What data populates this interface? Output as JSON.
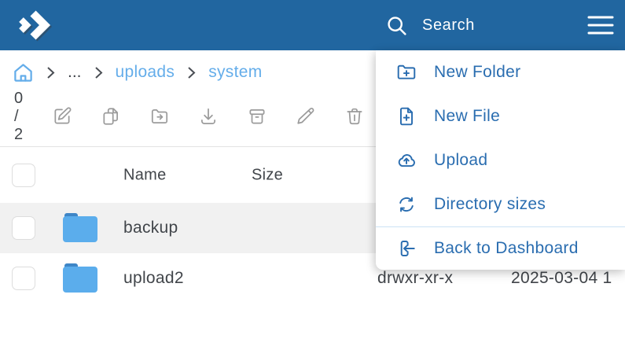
{
  "header": {
    "search_label": "Search",
    "colors": {
      "header_bg": "#2166A0",
      "menu_accent": "#2A6DB0",
      "link_blue": "#64ADEA"
    }
  },
  "breadcrumb": {
    "home_icon": "home-icon",
    "items": [
      {
        "label": "..."
      },
      {
        "label": "uploads"
      },
      {
        "label": "system"
      }
    ]
  },
  "toolbar": {
    "selection_count": "0 / 2",
    "buttons": [
      {
        "icon": "rename-icon"
      },
      {
        "icon": "copy-icon"
      },
      {
        "icon": "move-icon"
      },
      {
        "icon": "download-icon"
      },
      {
        "icon": "archive-icon"
      },
      {
        "icon": "edit-icon"
      },
      {
        "icon": "delete-icon"
      }
    ]
  },
  "table": {
    "columns": [
      {
        "label": "Name"
      },
      {
        "label": "Size"
      }
    ],
    "folder_colors": {
      "body": "#5BADEC",
      "tab": "#3E86C7"
    },
    "row_highlight": "#F1F1F1",
    "rows": [
      {
        "name": "backup",
        "type": "folder",
        "perms": "",
        "modified": ""
      },
      {
        "name": "upload2",
        "type": "folder",
        "perms": "drwxr-xr-x",
        "modified": "2025-03-04 1"
      }
    ]
  },
  "menu": {
    "items": [
      {
        "label": "New Folder",
        "icon": "folder-plus-icon"
      },
      {
        "label": "New File",
        "icon": "file-plus-icon"
      },
      {
        "label": "Upload",
        "icon": "cloud-upload-icon"
      },
      {
        "label": "Directory sizes",
        "icon": "sync-icon"
      },
      {
        "label": "Back to Dashboard",
        "icon": "back-arrow-icon"
      }
    ]
  }
}
